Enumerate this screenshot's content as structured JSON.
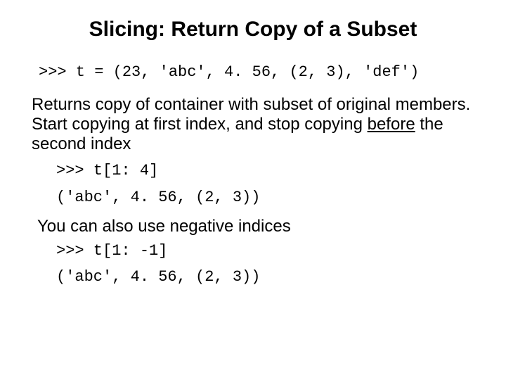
{
  "title": "Slicing: Return Copy of a Subset",
  "code_example1": ">>> t = (23, 'abc', 4. 56, (2, 3), 'def')",
  "para1_a": "Returns copy of container with subset of original members.  Start copying at first index, and stop copying ",
  "para1_b": "before",
  "para1_c": " the second index",
  "slice1_in": ">>> t[1: 4]",
  "slice1_out": "('abc', 4. 56, (2, 3))",
  "para2": "You can also use negative indices",
  "slice2_in": ">>> t[1: -1]",
  "slice2_out": "('abc', 4. 56, (2, 3))"
}
